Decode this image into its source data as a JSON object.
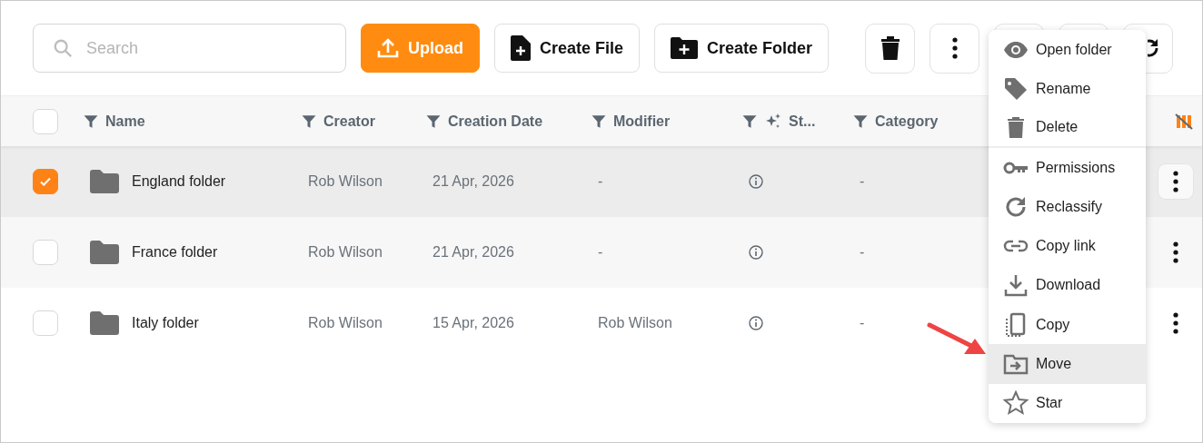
{
  "toolbar": {
    "search": {
      "placeholder": "Search"
    },
    "buttons": [
      {
        "kind": "upload",
        "label": "Upload"
      },
      {
        "kind": "file",
        "label": "Create File"
      },
      {
        "kind": "folder",
        "label": "Create Folder"
      }
    ],
    "icon_buttons": [
      {
        "kind": "delete"
      },
      {
        "kind": "more"
      },
      {
        "kind": "hidden"
      },
      {
        "kind": "hidden"
      },
      {
        "kind": "refresh"
      }
    ]
  },
  "table": {
    "all_checked": false,
    "columns": [
      {
        "label": "Name",
        "kind": "plain"
      },
      {
        "label": "Creator",
        "kind": "plain"
      },
      {
        "label": "Creation Date",
        "kind": "plain"
      },
      {
        "label": "Modifier",
        "kind": "plain"
      },
      {
        "label": "St...",
        "kind": "ai"
      },
      {
        "label": "Category",
        "kind": "plain"
      }
    ],
    "rows": [
      {
        "checked": true,
        "name": "England folder",
        "creator": "Rob Wilson",
        "date": "21 Apr, 2026",
        "modifier": "-",
        "category": "-"
      },
      {
        "checked": false,
        "name": "France folder",
        "creator": "Rob Wilson",
        "date": "21 Apr, 2026",
        "modifier": "-",
        "category": "-"
      },
      {
        "checked": false,
        "name": "Italy folder",
        "creator": "Rob Wilson",
        "date": "15 Apr, 2026",
        "modifier": "Rob Wilson",
        "category": "-"
      }
    ]
  },
  "context_menu": {
    "items": [
      {
        "kind": "open",
        "label": "Open folder",
        "selected": false,
        "divider_after": false
      },
      {
        "kind": "tag",
        "label": "Rename",
        "selected": false,
        "divider_after": false
      },
      {
        "kind": "delete",
        "label": "Delete",
        "selected": false,
        "divider_after": true
      },
      {
        "kind": "key",
        "label": "Permissions",
        "selected": false,
        "divider_after": false
      },
      {
        "kind": "reclassify",
        "label": "Reclassify",
        "selected": false,
        "divider_after": false
      },
      {
        "kind": "link",
        "label": "Copy link",
        "selected": false,
        "divider_after": false
      },
      {
        "kind": "download",
        "label": "Download",
        "selected": false,
        "divider_after": false
      },
      {
        "kind": "copy",
        "label": "Copy",
        "selected": false,
        "divider_after": false
      },
      {
        "kind": "move",
        "label": "Move",
        "selected": true,
        "divider_after": false
      },
      {
        "kind": "star",
        "label": "Star",
        "selected": false,
        "divider_after": false
      }
    ]
  }
}
